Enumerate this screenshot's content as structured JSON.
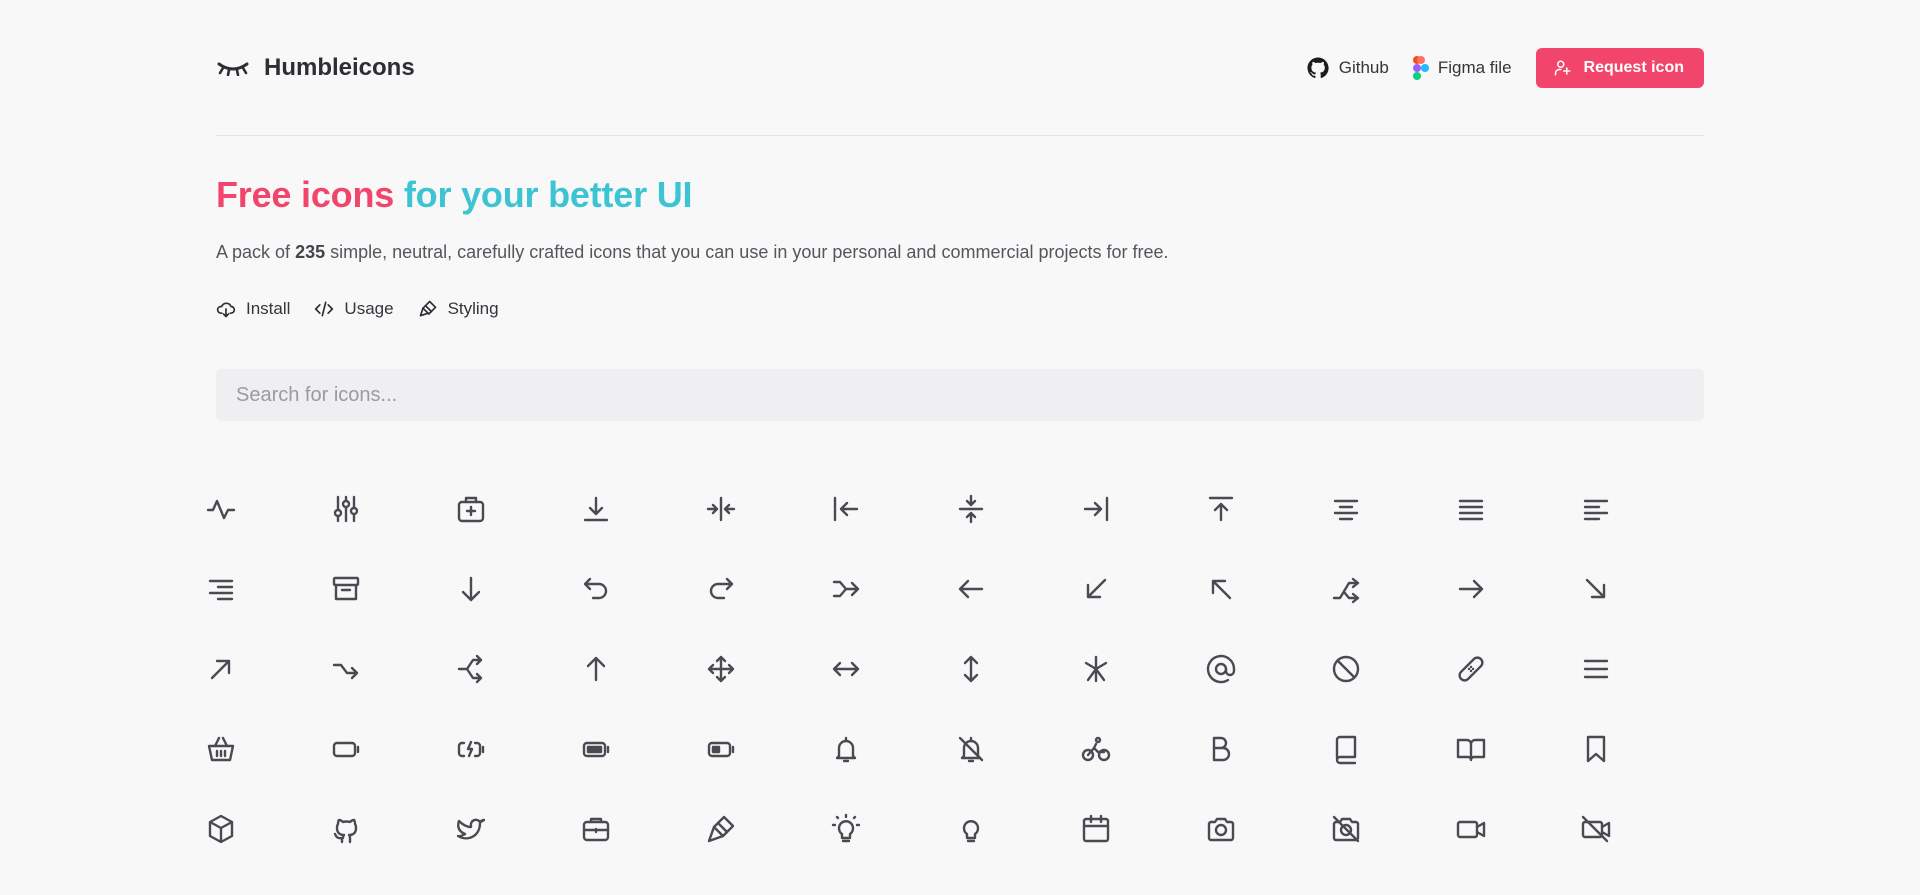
{
  "brand": {
    "name": "Humbleicons"
  },
  "nav": {
    "github_label": "Github",
    "figma_label": "Figma file",
    "request_label": "Request icon"
  },
  "hero": {
    "title_part1": "Free icons",
    "title_part2": "for your better UI",
    "desc_prefix": "A pack of ",
    "desc_count": "235",
    "desc_suffix": " simple, neutral, carefully crafted icons that you can use in your personal and commercial projects for free."
  },
  "links": {
    "install": "Install",
    "usage": "Usage",
    "styling": "Styling"
  },
  "search": {
    "placeholder": "Search for icons..."
  },
  "colors": {
    "accent": "#f2456b",
    "secondary": "#3cc4d3",
    "icon": "#4a4a52"
  },
  "icons": [
    "activity",
    "adjustments",
    "aid",
    "align-bottom",
    "align-center",
    "align-left",
    "align-middle",
    "align-right",
    "align-top",
    "align-text-center",
    "align-text-justify",
    "align-text-left",
    "align-text-right",
    "archive",
    "arrow-down",
    "arrow-go-back",
    "arrow-go-forward",
    "arrow-join",
    "arrow-left",
    "arrow-left-down",
    "arrow-left-up",
    "arrow-merge",
    "arrow-right",
    "arrow-right-down",
    "arrow-right-up",
    "arrow-split",
    "arrow-split-alt",
    "arrow-up",
    "arrows",
    "arrows-horizontal",
    "arrows-vertical",
    "asterisk",
    "at-symbol",
    "ban",
    "bandage",
    "bars",
    "basket",
    "battery-empty",
    "battery-charging",
    "battery-full",
    "battery-half",
    "bell",
    "bell-off",
    "bike",
    "bold",
    "book",
    "book-open",
    "bookmark",
    "box",
    "brand-github",
    "brand-twitter",
    "briefcase",
    "brush",
    "bulb",
    "bulb-off",
    "calendar",
    "camera",
    "camera-off",
    "camcorder",
    "camcorder-off"
  ]
}
